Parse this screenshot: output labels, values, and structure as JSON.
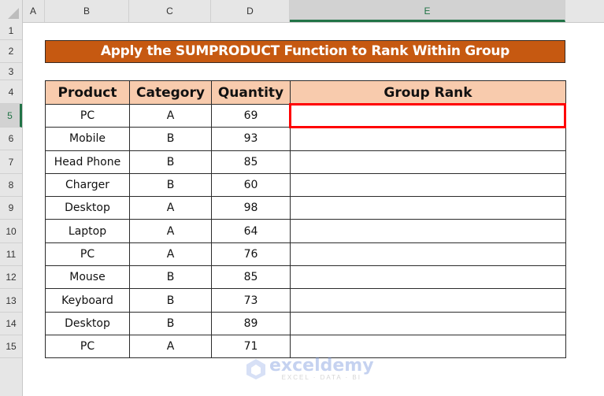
{
  "spreadsheet": {
    "columns": [
      "A",
      "B",
      "C",
      "D",
      "E"
    ],
    "selected_column": "E",
    "rows": [
      "1",
      "2",
      "3",
      "4",
      "5",
      "6",
      "7",
      "8",
      "9",
      "10",
      "11",
      "12",
      "13",
      "14",
      "15"
    ],
    "selected_row": "5",
    "active_cell": "E5"
  },
  "title": "Apply the SUMPRODUCT Function to Rank Within Group",
  "table": {
    "headers": [
      "Product",
      "Category",
      "Quantity",
      "Group Rank"
    ],
    "rows": [
      {
        "product": "PC",
        "category": "A",
        "quantity": "69",
        "rank": ""
      },
      {
        "product": "Mobile",
        "category": "B",
        "quantity": "93",
        "rank": ""
      },
      {
        "product": "Head Phone",
        "category": "B",
        "quantity": "85",
        "rank": ""
      },
      {
        "product": "Charger",
        "category": "B",
        "quantity": "60",
        "rank": ""
      },
      {
        "product": "Desktop",
        "category": "A",
        "quantity": "98",
        "rank": ""
      },
      {
        "product": "Laptop",
        "category": "A",
        "quantity": "64",
        "rank": ""
      },
      {
        "product": "PC",
        "category": "A",
        "quantity": "76",
        "rank": ""
      },
      {
        "product": "Mouse",
        "category": "B",
        "quantity": "85",
        "rank": ""
      },
      {
        "product": "Keyboard",
        "category": "B",
        "quantity": "73",
        "rank": ""
      },
      {
        "product": "Desktop",
        "category": "B",
        "quantity": "89",
        "rank": ""
      },
      {
        "product": "PC",
        "category": "A",
        "quantity": "71",
        "rank": ""
      }
    ]
  },
  "colors": {
    "title_fill": "#c65911",
    "header_fill": "#f8cbad",
    "active_border": "#ff0000",
    "excel_green": "#217346"
  },
  "watermark": {
    "brand": "exceldemy",
    "tagline": "EXCEL · DATA · BI"
  }
}
